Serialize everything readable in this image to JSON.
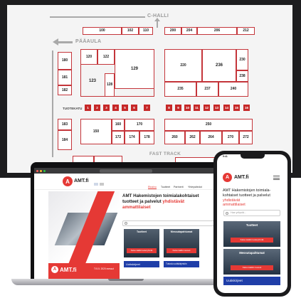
{
  "floor_plan": {
    "hall_label": "C-HALLI",
    "lobby_label": "PÄÄAULA",
    "fast_track_label": "FAST TRACK",
    "tuotekatu_label": "TUOTEKATU",
    "booths": {
      "b100": "100",
      "b102": "102",
      "b110": "110",
      "b200": "200",
      "b204": "204",
      "b206": "206",
      "b212": "212",
      "b180": "180",
      "b181": "181",
      "b182": "182",
      "b120": "120",
      "b122": "122",
      "b123": "123",
      "b128": "128",
      "b129": "129",
      "b220": "220",
      "b236": "236",
      "b230": "230",
      "b238": "238",
      "b235": "235",
      "b237": "237",
      "b240": "240",
      "b183": "183",
      "b184": "184",
      "b150": "150",
      "b160": "160",
      "b170": "170",
      "b172": "172",
      "b174": "174",
      "b178": "178",
      "b250": "250",
      "b260": "260",
      "b262": "262",
      "b264": "264",
      "b270": "270",
      "b272": "272"
    },
    "product_street": [
      "1",
      "2",
      "3",
      "4",
      "5",
      "6",
      "7",
      "8",
      "9",
      "10",
      "11",
      "12",
      "13",
      "14",
      "15",
      "16"
    ]
  },
  "laptop": {
    "logo_text": "AMT.fi",
    "nav": [
      "Etusivu",
      "Tuotteet",
      "Partnerit",
      "Yhteystiedot"
    ],
    "hero_line1": "AMT Hakemistojen toimialakohtaiset",
    "hero_line2": "tuotteet ja palvelut",
    "hero_accent": "yhdistävät",
    "hero_line3": "ammattilaiset",
    "card1_title": "Tuotteet",
    "card1_button": "Katso kaikki tuoteryhmät",
    "card2_title": "Messutapahtumat",
    "card2_button": "Katso kaikki messut",
    "news_left": "Uutiskirjeet",
    "news_right": "Tutustu uutiskirjeisiin",
    "footer_logo": "AMT.fi",
    "footer_text": "Ti 5.5. 2020 messut"
  },
  "phone": {
    "time": "9:41",
    "logo_text": "AMT.fi",
    "title_line1": "AMT Hakemistojen toimiala-",
    "title_line2": "kohtaiset tuotteet ja palvelut",
    "title_accent": "yhdistävät",
    "title_line3": "ammattilaiset",
    "search_placeholder": "Hae yritystä...",
    "card1_title": "Tuotteet",
    "card1_button": "Katso kaikki tuoteryhmät",
    "card2_title": "Messutapahtumat",
    "card2_button": "Katso kaikki messut",
    "news": "Uutiskirjeet"
  },
  "colors": {
    "accent": "#e53935",
    "booth_border": "#c4353a",
    "news_blue": "#1f3ea8"
  }
}
